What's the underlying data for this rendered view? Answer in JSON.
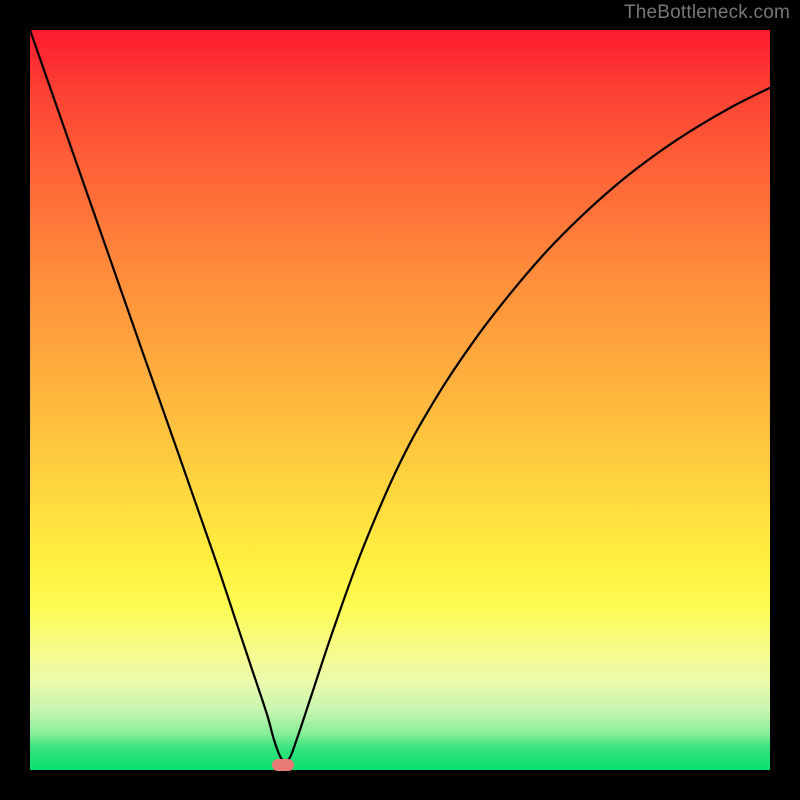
{
  "watermark": "TheBottleneck.com",
  "chart_data": {
    "type": "line",
    "title": "",
    "xlabel": "",
    "ylabel": "",
    "xlim": [
      0,
      100
    ],
    "ylim": [
      0,
      100
    ],
    "background_gradient": {
      "top_color": "#fb1a30",
      "bottom_color": "#08df6e"
    },
    "curve": {
      "description": "V-shaped bottleneck curve with minimum near x=34",
      "x": [
        0,
        5,
        10,
        15,
        20,
        25,
        28,
        30,
        32,
        33,
        34,
        35,
        36,
        38,
        41,
        45,
        50,
        55,
        60,
        65,
        70,
        75,
        80,
        85,
        90,
        95,
        100
      ],
      "y": [
        100,
        85.7,
        71.4,
        57.1,
        42.9,
        28.6,
        19.6,
        13.6,
        7.6,
        4.0,
        1.5,
        1.5,
        4.0,
        10.0,
        19.0,
        30.0,
        41.5,
        50.5,
        58.0,
        64.5,
        70.3,
        75.3,
        79.7,
        83.5,
        86.8,
        89.7,
        92.2
      ]
    },
    "marker": {
      "x": 34.2,
      "y": 0.7,
      "color": "#e77a73"
    }
  }
}
